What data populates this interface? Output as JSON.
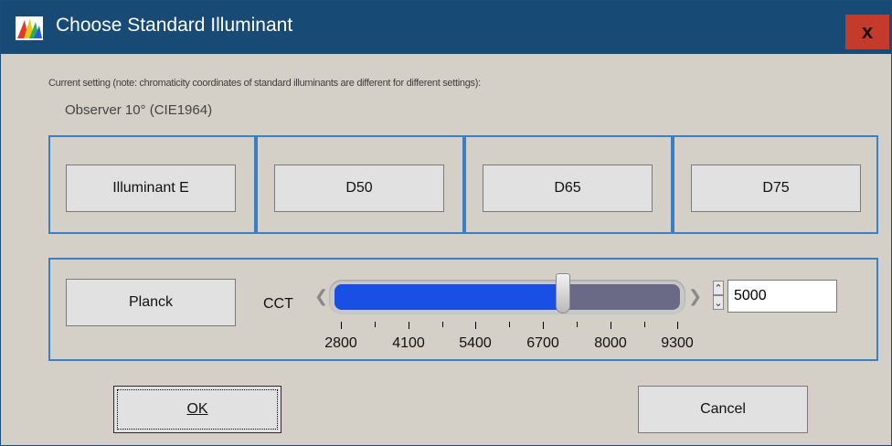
{
  "window": {
    "title": "Choose Standard Illuminant",
    "close_label": "x"
  },
  "note": "Current setting (note: chromaticity coordinates of standard illuminants are different for different settings):",
  "observer": "Observer 10° (CIE1964)",
  "illuminants": [
    {
      "label": "Illuminant E"
    },
    {
      "label": "D50"
    },
    {
      "label": "D65"
    },
    {
      "label": "D75"
    }
  ],
  "planck": {
    "button_label": "Planck",
    "cct_label": "CCT",
    "slider": {
      "min": 2800,
      "max": 9300,
      "value": 5000
    },
    "tick_labels": [
      "2800",
      "4100",
      "5400",
      "6700",
      "8000",
      "9300"
    ],
    "value": "5000",
    "spin_up": "⌃",
    "spin_down": "⌄"
  },
  "buttons": {
    "ok": "OK",
    "cancel": "Cancel"
  },
  "colors": {
    "titlebar": "#184a76",
    "close": "#c43a2b",
    "panel_border": "#3c7fc4",
    "slider_fill": "#1a4fe6"
  }
}
